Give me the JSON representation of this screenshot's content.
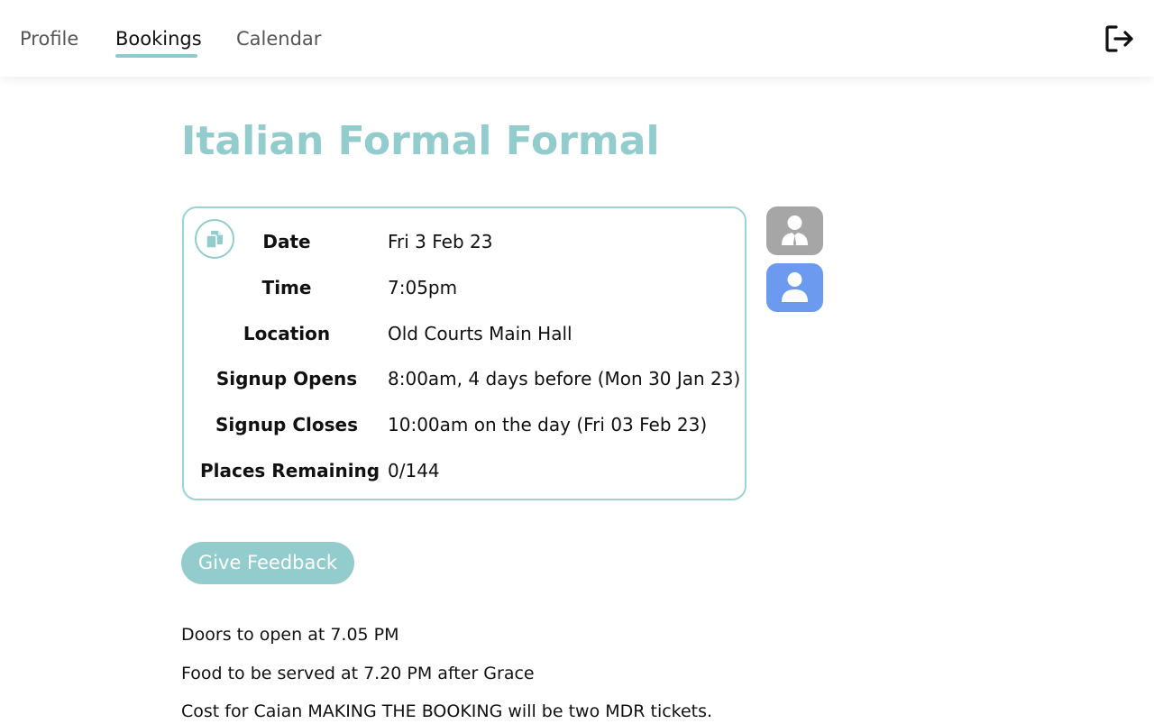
{
  "nav": {
    "tabs": [
      {
        "label": "Profile",
        "active": false
      },
      {
        "label": "Bookings",
        "active": true
      },
      {
        "label": "Calendar",
        "active": false
      }
    ],
    "logout_icon": "logout-arrow-icon"
  },
  "event": {
    "title": "Italian Formal Formal",
    "details": [
      {
        "label": "Date",
        "value": "Fri 3 Feb 23"
      },
      {
        "label": "Time",
        "value": "7:05pm"
      },
      {
        "label": "Location",
        "value": "Old Courts Main Hall"
      },
      {
        "label": "Signup Opens",
        "value": "8:00am, 4 days before (Mon 30 Jan 23)"
      },
      {
        "label": "Signup Closes",
        "value": "10:00am on the day (Fri 03 Feb 23)"
      },
      {
        "label": "Places Remaining",
        "value": "0/144"
      }
    ],
    "copy_icon": "copy-icon",
    "side_buttons": [
      {
        "icon": "formal-person-icon",
        "color": "#a6a6a6"
      },
      {
        "icon": "person-icon",
        "color": "#6b9aee"
      }
    ]
  },
  "feedback_button": "Give Feedback",
  "description": [
    "Doors to open at 7.05 PM",
    "Food to be served at 7.20 PM after Grace",
    "Cost for Caian MAKING THE BOOKING will be two MDR tickets."
  ],
  "colors": {
    "accent": "#93cccc",
    "card_border": "#9ed2d2",
    "guest_button": "#6b9aee",
    "formal_button": "#a6a6a6"
  }
}
